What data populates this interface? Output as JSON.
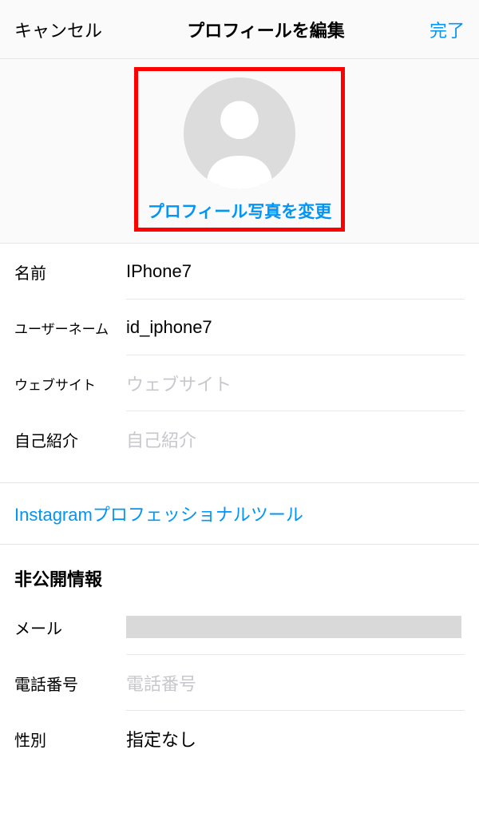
{
  "header": {
    "cancel": "キャンセル",
    "title": "プロフィールを編集",
    "done": "完了"
  },
  "photo": {
    "change_label": "プロフィール写真を変更"
  },
  "fields": {
    "name": {
      "label": "名前",
      "value": "IPhone7"
    },
    "username": {
      "label": "ユーザーネーム",
      "value": "id_iphone7"
    },
    "website": {
      "label": "ウェブサイト",
      "placeholder": "ウェブサイト"
    },
    "bio": {
      "label": "自己紹介",
      "placeholder": "自己紹介"
    }
  },
  "pro_tools_link": "Instagramプロフェッショナルツール",
  "private_section": {
    "heading": "非公開情報",
    "email": {
      "label": "メール"
    },
    "phone": {
      "label": "電話番号",
      "placeholder": "電話番号"
    },
    "gender": {
      "label": "性別",
      "value": "指定なし"
    }
  }
}
